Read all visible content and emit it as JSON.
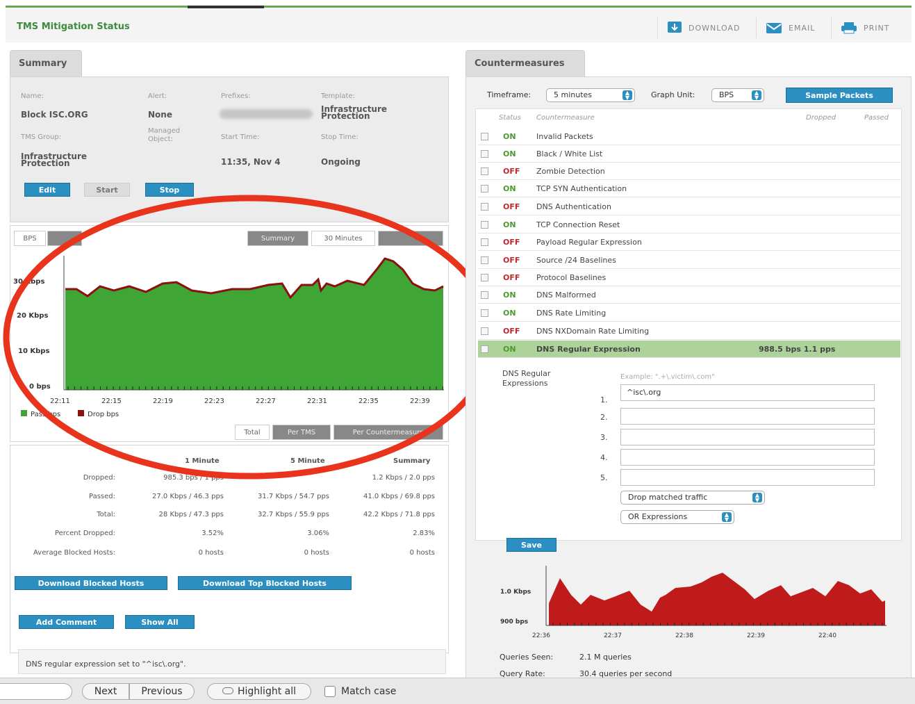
{
  "header": {
    "title": "TMS Mitigation Status",
    "download_label": "DOWNLOAD",
    "email_label": "EMAIL",
    "print_label": "PRINT"
  },
  "summary": {
    "tab_label": "Summary",
    "name_label": "Name:",
    "name_value": "Block ISC.ORG",
    "alert_label": "Alert:",
    "alert_value": "None",
    "prefixes_label": "Prefixes:",
    "template_label": "Template:",
    "template_value": "Infrastructure Protection",
    "tms_group_label": "TMS Group:",
    "tms_group_value": "Infrastructure Protection",
    "managed_object_label": "Managed Object:",
    "start_time_label": "Start Time:",
    "start_time_value": "11:35, Nov 4",
    "stop_time_label": "Stop Time:",
    "stop_time_value": "Ongoing",
    "edit_label": "Edit",
    "start_label": "Start",
    "stop_label": "Stop"
  },
  "graph": {
    "tab_bps": "BPS",
    "tab_summary": "Summary",
    "tab_30min": "30 Minutes",
    "y_ticks": [
      "30 Kbps",
      "20 Kbps",
      "10 Kbps",
      "0 bps"
    ],
    "x_ticks": [
      "22:11",
      "22:15",
      "22:19",
      "22:23",
      "22:27",
      "22:31",
      "22:35",
      "22:39"
    ],
    "legend_pass": "Pass bps",
    "legend_drop": "Drop bps",
    "tab_total": "Total",
    "tab_per_tms": "Per TMS",
    "tab_per_cm": "Per Countermeasure"
  },
  "stats": {
    "headers": [
      "1 Minute",
      "5 Minute",
      "Summary"
    ],
    "rows": [
      {
        "label": "Dropped:",
        "v1": "985.3 bps / 1 pps",
        "v2": "",
        "v3": "1.2 Kbps / 2.0 pps"
      },
      {
        "label": "Passed:",
        "v1": "27.0 Kbps / 46.3 pps",
        "v2": "31.7 Kbps / 54.7 pps",
        "v3": "41.0 Kbps / 69.8 pps"
      },
      {
        "label": "Total:",
        "v1": "28 Kbps / 47.3 pps",
        "v2": "32.7 Kbps / 55.9 pps",
        "v3": "42.2 Kbps / 71.8 pps"
      },
      {
        "label": "Percent Dropped:",
        "v1": "3.52%",
        "v2": "3.06%",
        "v3": "2.83%"
      },
      {
        "label": "Average Blocked Hosts:",
        "v1": "0 hosts",
        "v2": "0 hosts",
        "v3": "0 hosts"
      }
    ],
    "download_blocked": "Download Blocked Hosts",
    "download_top_blocked": "Download Top Blocked Hosts",
    "add_comment": "Add Comment",
    "show_all": "Show All",
    "comment": "DNS regular expression set to \"^isc\\.org\"."
  },
  "countermeasures": {
    "tab_label": "Countermeasures",
    "timeframe_label": "Timeframe:",
    "timeframe_value": "5 minutes",
    "graph_unit_label": "Graph Unit:",
    "graph_unit_value": "BPS",
    "sample_packets": "Sample Packets",
    "col_status": "Status",
    "col_countermeasure": "Countermeasure",
    "col_dropped": "Dropped",
    "col_passed": "Passed",
    "rows": [
      {
        "status": "ON",
        "name": "Invalid Packets"
      },
      {
        "status": "ON",
        "name": "Black / White List"
      },
      {
        "status": "OFF",
        "name": "Zombie Detection"
      },
      {
        "status": "ON",
        "name": "TCP SYN Authentication"
      },
      {
        "status": "OFF",
        "name": "DNS Authentication"
      },
      {
        "status": "ON",
        "name": "TCP Connection Reset"
      },
      {
        "status": "OFF",
        "name": "Payload Regular Expression"
      },
      {
        "status": "OFF",
        "name": "Source /24 Baselines"
      },
      {
        "status": "OFF",
        "name": "Protocol Baselines"
      },
      {
        "status": "ON",
        "name": "DNS Malformed"
      },
      {
        "status": "ON",
        "name": "DNS Rate Limiting"
      },
      {
        "status": "OFF",
        "name": "DNS NXDomain Rate Limiting"
      }
    ],
    "selected": {
      "status": "ON",
      "name": "DNS Regular Expression",
      "dropped": "988.5 bps 1.1 pps"
    },
    "dns_label": "DNS Regular Expressions",
    "example": "Example:  \".+\\.victim\\.com\"",
    "expr_numbers": [
      "1.",
      "2.",
      "3.",
      "4.",
      "5."
    ],
    "expr_values": [
      "^isc\\.org",
      "",
      "",
      "",
      ""
    ],
    "action_value": "Drop matched traffic",
    "combine_value": "OR Expressions",
    "save_label": "Save",
    "mini_y_ticks": [
      "1.0 Kbps",
      "900 bps"
    ],
    "mini_x_ticks": [
      "22:36",
      "22:37",
      "22:38",
      "22:39",
      "22:40"
    ],
    "queries_seen_label": "Queries Seen:",
    "queries_seen_value": "2.1 M queries",
    "query_rate_label": "Query Rate:",
    "query_rate_value": "30.4 queries per second"
  },
  "findbar": {
    "next": "Next",
    "previous": "Previous",
    "highlight_all": "Highlight all",
    "match_case": "Match case"
  },
  "colors": {
    "annotation": "#e8341c",
    "pass": "#3fa535",
    "drop": "#8b1010",
    "accent": "#2b8fc2"
  }
}
